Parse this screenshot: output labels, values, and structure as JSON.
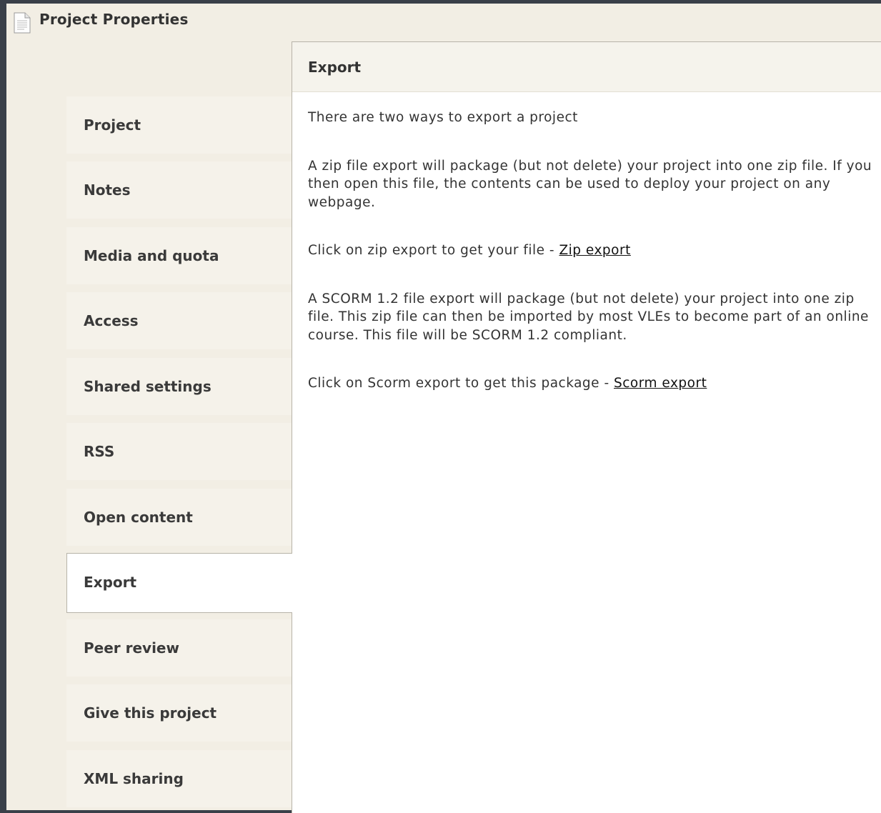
{
  "window": {
    "title": "Project Properties",
    "icon": "document-icon"
  },
  "sidebar": {
    "tabs": [
      {
        "label": "Project"
      },
      {
        "label": "Notes"
      },
      {
        "label": "Media and quota"
      },
      {
        "label": "Access"
      },
      {
        "label": "Shared settings"
      },
      {
        "label": "RSS"
      },
      {
        "label": "Open content"
      },
      {
        "label": "Export"
      },
      {
        "label": "Peer review"
      },
      {
        "label": "Give this project"
      },
      {
        "label": "XML sharing"
      }
    ],
    "active_tab": "Export"
  },
  "panel": {
    "title": "Export",
    "intro": "There are two ways to export a project",
    "zip_description": "A zip file export will package (but not delete) your project into one zip file. If you then open this file, the contents can be used to deploy your project on any webpage.",
    "zip_prompt": "Click on zip export to get your file - ",
    "zip_link": "Zip export",
    "scorm_description": "A SCORM 1.2 file export will package (but not delete) your project into one zip file. This zip file can then be imported by most VLEs to become part of an online course. This file will be SCORM 1.2 compliant.",
    "scorm_prompt": "Click on Scorm export to get this package - ",
    "scorm_link": "Scorm export"
  },
  "colors": {
    "background": "#3a4049",
    "window": "#f2eee4",
    "tab": "#f5f2ea",
    "panel": "#ffffff",
    "text": "#333333"
  }
}
